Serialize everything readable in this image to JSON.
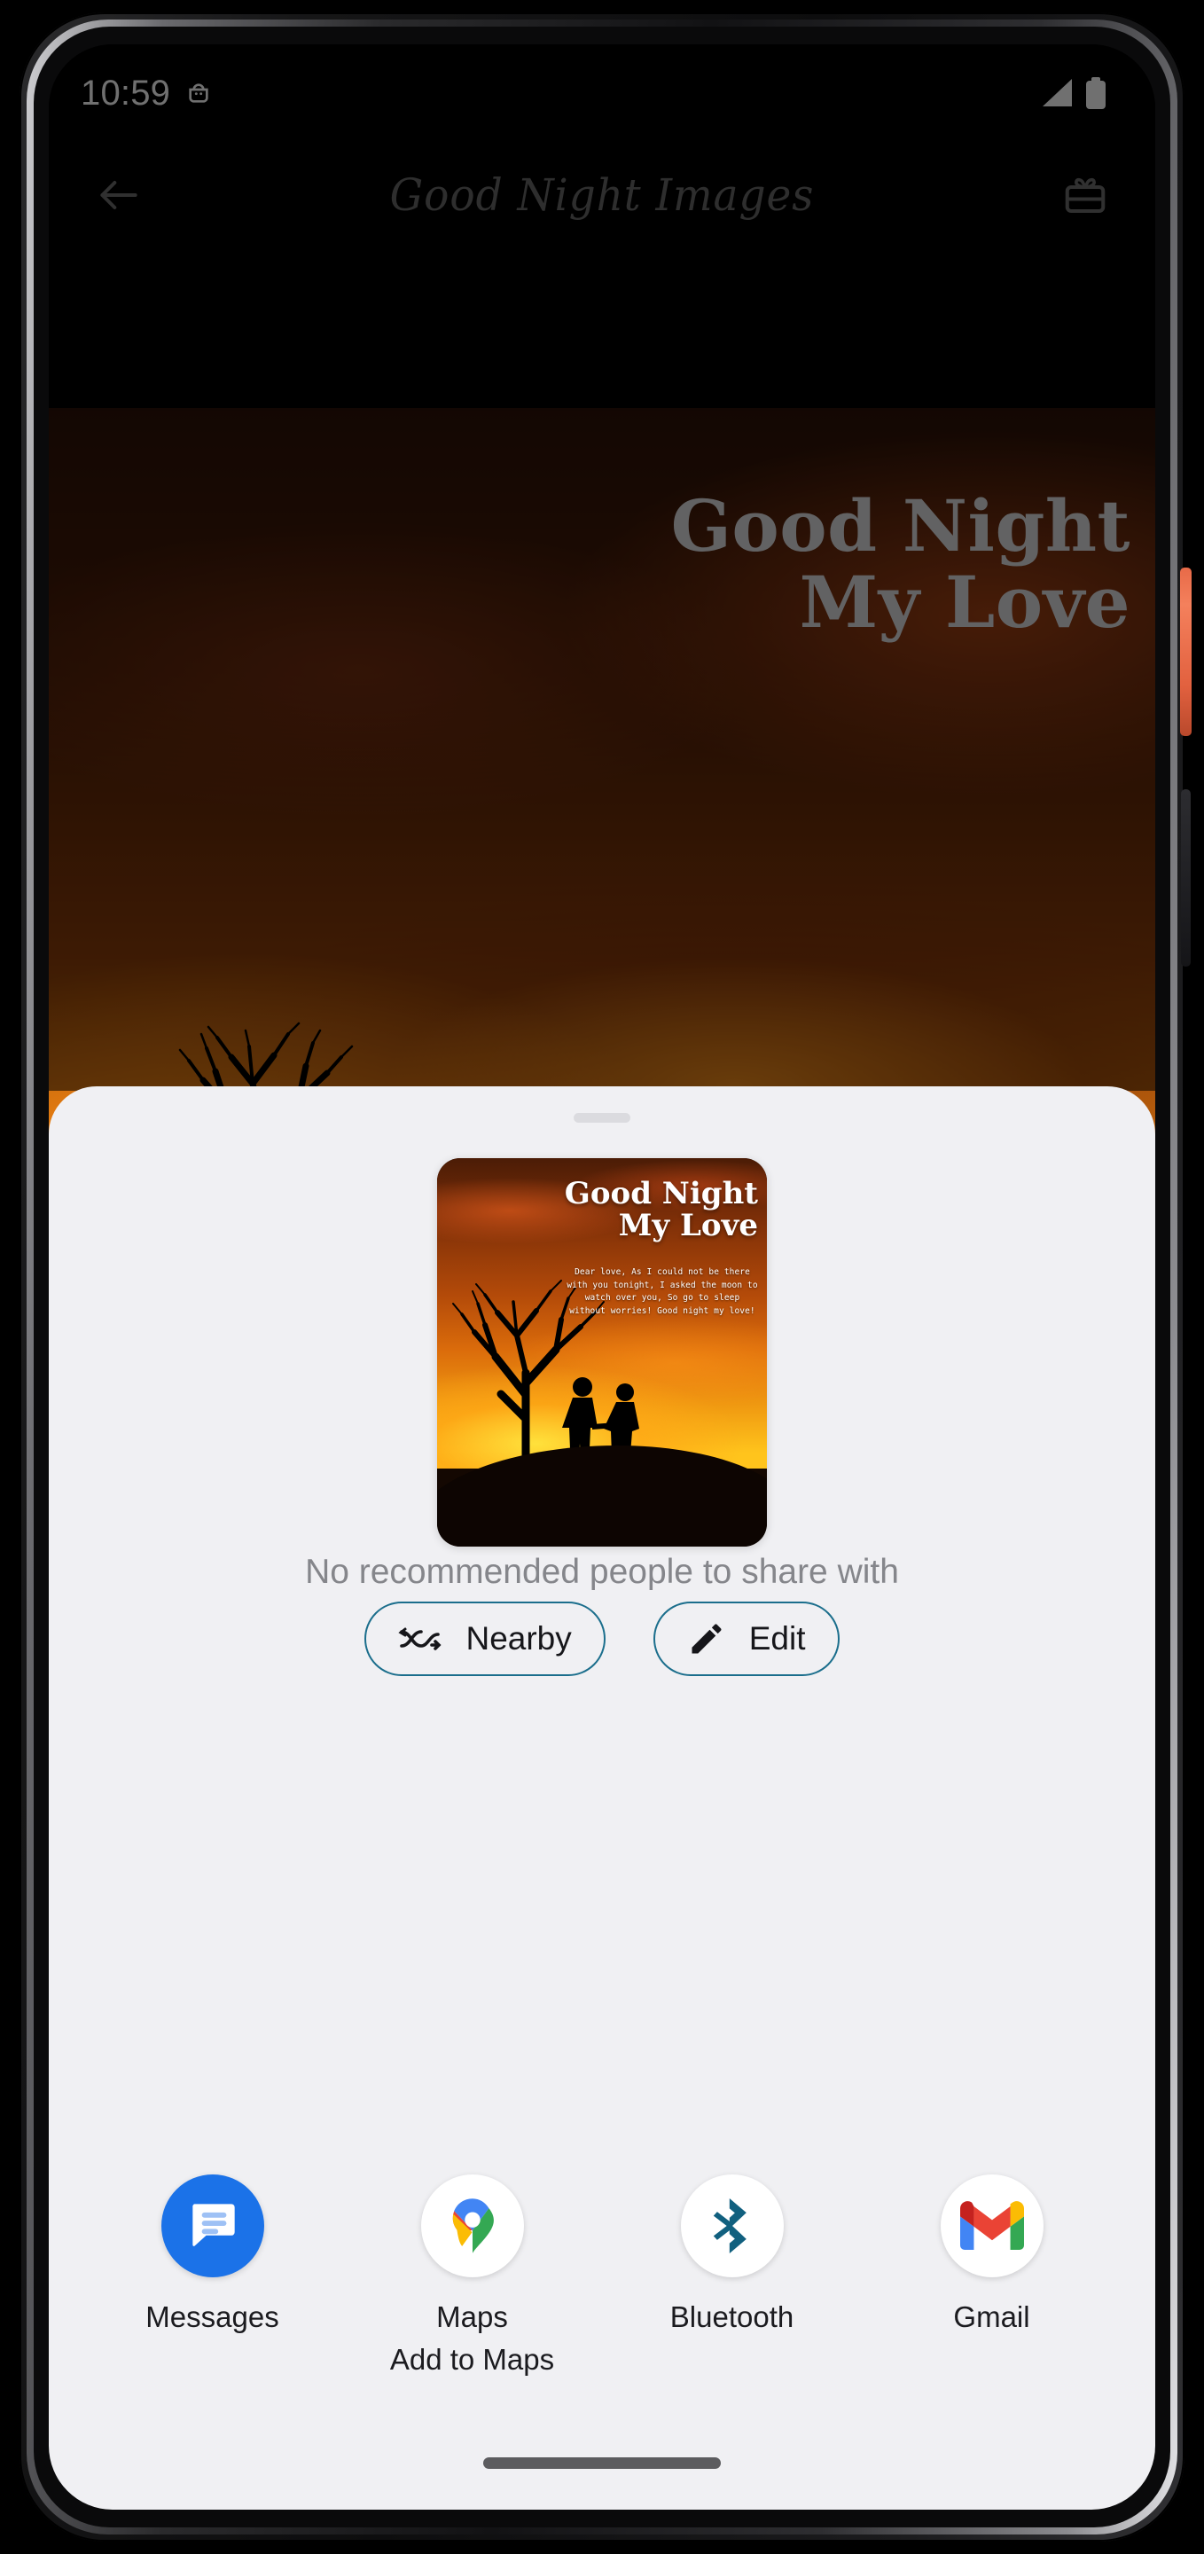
{
  "status_bar": {
    "time": "10:59",
    "left_icons": [
      "android-debug-icon"
    ],
    "right_icons": [
      "cellular-signal-icon",
      "battery-full-icon"
    ]
  },
  "app_bar": {
    "back_icon": "back-arrow-icon",
    "title": "Good Night Images",
    "action_icon": "gift-icon"
  },
  "wallpaper": {
    "heading_line1": "Good Night",
    "heading_line2": "My Love"
  },
  "share_sheet": {
    "handle": "drag-handle",
    "thumbnail": {
      "title_line1": "Good Night",
      "title_line2": "My Love",
      "message": "Dear love, As I could not be there with you tonight, I asked the moon to watch over you, So go to sleep without worries! Good night my love!"
    },
    "actions": [
      {
        "id": "nearby",
        "label": "Nearby",
        "icon": "nearby-share-icon"
      },
      {
        "id": "edit",
        "label": "Edit",
        "icon": "pencil-edit-icon"
      }
    ],
    "empty_state": "No recommended people to share with",
    "app_targets": [
      {
        "id": "messages",
        "name": "Messages",
        "subtitle": "",
        "icon": "messages-icon"
      },
      {
        "id": "maps",
        "name": "Maps",
        "subtitle": "Add to Maps",
        "icon": "maps-icon"
      },
      {
        "id": "bluetooth",
        "name": "Bluetooth",
        "subtitle": "",
        "icon": "bluetooth-icon"
      },
      {
        "id": "gmail",
        "name": "Gmail",
        "subtitle": "",
        "icon": "gmail-icon"
      }
    ]
  },
  "colors": {
    "sheet_bg": "#f0f0f3",
    "chip_outline": "#1b6e8c",
    "empty_text": "#85868b",
    "messages_blue": "#1b72e8",
    "bluetooth_blue": "#11607f",
    "gmail_red": "#ea4335",
    "power_button": "#ef7350"
  },
  "navigation": {
    "pill": "gesture-nav-pill"
  }
}
